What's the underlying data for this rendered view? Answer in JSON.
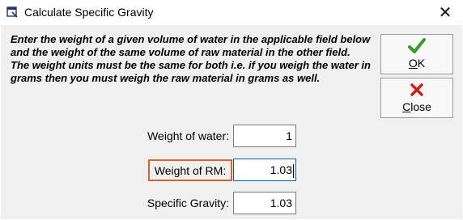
{
  "window": {
    "title": "Calculate Specific Gravity",
    "close_glyph": "✕",
    "icon": "calculator-window-icon"
  },
  "instructions": "Enter the weight of a given volume of water in the applicable field below and the weight of the same volume of raw material in the other field. The weight units must be the same for both i.e. if you weigh the water in grams then you must weigh the raw material in grams as well.",
  "buttons": {
    "ok_label": "OK",
    "ok_icon": "checkmark-icon",
    "close_label": "Close",
    "close_icon": "red-x-icon"
  },
  "fields": {
    "water_label": "Weight of water:",
    "water_value": "1",
    "rm_label": "Weight of RM:",
    "rm_value": "1.03",
    "sg_label": "Specific Gravity:",
    "sg_value": "1.03"
  },
  "colors": {
    "accent_green": "#3a9a2a",
    "accent_red": "#cc1f1f",
    "focus_outline": "#d9652b"
  }
}
